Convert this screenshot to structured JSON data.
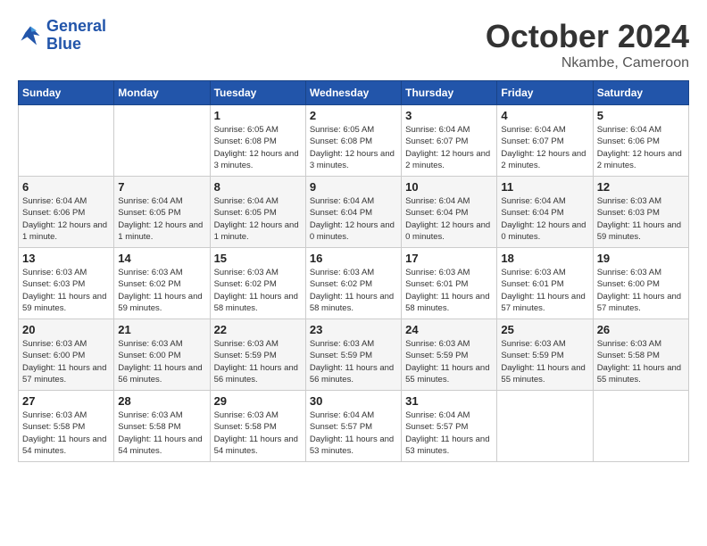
{
  "header": {
    "logo_line1": "General",
    "logo_line2": "Blue",
    "month": "October 2024",
    "location": "Nkambe, Cameroon"
  },
  "weekdays": [
    "Sunday",
    "Monday",
    "Tuesday",
    "Wednesday",
    "Thursday",
    "Friday",
    "Saturday"
  ],
  "weeks": [
    [
      {
        "day": "",
        "info": ""
      },
      {
        "day": "",
        "info": ""
      },
      {
        "day": "1",
        "info": "Sunrise: 6:05 AM\nSunset: 6:08 PM\nDaylight: 12 hours\nand 3 minutes."
      },
      {
        "day": "2",
        "info": "Sunrise: 6:05 AM\nSunset: 6:08 PM\nDaylight: 12 hours\nand 3 minutes."
      },
      {
        "day": "3",
        "info": "Sunrise: 6:04 AM\nSunset: 6:07 PM\nDaylight: 12 hours\nand 2 minutes."
      },
      {
        "day": "4",
        "info": "Sunrise: 6:04 AM\nSunset: 6:07 PM\nDaylight: 12 hours\nand 2 minutes."
      },
      {
        "day": "5",
        "info": "Sunrise: 6:04 AM\nSunset: 6:06 PM\nDaylight: 12 hours\nand 2 minutes."
      }
    ],
    [
      {
        "day": "6",
        "info": "Sunrise: 6:04 AM\nSunset: 6:06 PM\nDaylight: 12 hours\nand 1 minute."
      },
      {
        "day": "7",
        "info": "Sunrise: 6:04 AM\nSunset: 6:05 PM\nDaylight: 12 hours\nand 1 minute."
      },
      {
        "day": "8",
        "info": "Sunrise: 6:04 AM\nSunset: 6:05 PM\nDaylight: 12 hours\nand 1 minute."
      },
      {
        "day": "9",
        "info": "Sunrise: 6:04 AM\nSunset: 6:04 PM\nDaylight: 12 hours\nand 0 minutes."
      },
      {
        "day": "10",
        "info": "Sunrise: 6:04 AM\nSunset: 6:04 PM\nDaylight: 12 hours\nand 0 minutes."
      },
      {
        "day": "11",
        "info": "Sunrise: 6:04 AM\nSunset: 6:04 PM\nDaylight: 12 hours\nand 0 minutes."
      },
      {
        "day": "12",
        "info": "Sunrise: 6:03 AM\nSunset: 6:03 PM\nDaylight: 11 hours\nand 59 minutes."
      }
    ],
    [
      {
        "day": "13",
        "info": "Sunrise: 6:03 AM\nSunset: 6:03 PM\nDaylight: 11 hours\nand 59 minutes."
      },
      {
        "day": "14",
        "info": "Sunrise: 6:03 AM\nSunset: 6:02 PM\nDaylight: 11 hours\nand 59 minutes."
      },
      {
        "day": "15",
        "info": "Sunrise: 6:03 AM\nSunset: 6:02 PM\nDaylight: 11 hours\nand 58 minutes."
      },
      {
        "day": "16",
        "info": "Sunrise: 6:03 AM\nSunset: 6:02 PM\nDaylight: 11 hours\nand 58 minutes."
      },
      {
        "day": "17",
        "info": "Sunrise: 6:03 AM\nSunset: 6:01 PM\nDaylight: 11 hours\nand 58 minutes."
      },
      {
        "day": "18",
        "info": "Sunrise: 6:03 AM\nSunset: 6:01 PM\nDaylight: 11 hours\nand 57 minutes."
      },
      {
        "day": "19",
        "info": "Sunrise: 6:03 AM\nSunset: 6:00 PM\nDaylight: 11 hours\nand 57 minutes."
      }
    ],
    [
      {
        "day": "20",
        "info": "Sunrise: 6:03 AM\nSunset: 6:00 PM\nDaylight: 11 hours\nand 57 minutes."
      },
      {
        "day": "21",
        "info": "Sunrise: 6:03 AM\nSunset: 6:00 PM\nDaylight: 11 hours\nand 56 minutes."
      },
      {
        "day": "22",
        "info": "Sunrise: 6:03 AM\nSunset: 5:59 PM\nDaylight: 11 hours\nand 56 minutes."
      },
      {
        "day": "23",
        "info": "Sunrise: 6:03 AM\nSunset: 5:59 PM\nDaylight: 11 hours\nand 56 minutes."
      },
      {
        "day": "24",
        "info": "Sunrise: 6:03 AM\nSunset: 5:59 PM\nDaylight: 11 hours\nand 55 minutes."
      },
      {
        "day": "25",
        "info": "Sunrise: 6:03 AM\nSunset: 5:59 PM\nDaylight: 11 hours\nand 55 minutes."
      },
      {
        "day": "26",
        "info": "Sunrise: 6:03 AM\nSunset: 5:58 PM\nDaylight: 11 hours\nand 55 minutes."
      }
    ],
    [
      {
        "day": "27",
        "info": "Sunrise: 6:03 AM\nSunset: 5:58 PM\nDaylight: 11 hours\nand 54 minutes."
      },
      {
        "day": "28",
        "info": "Sunrise: 6:03 AM\nSunset: 5:58 PM\nDaylight: 11 hours\nand 54 minutes."
      },
      {
        "day": "29",
        "info": "Sunrise: 6:03 AM\nSunset: 5:58 PM\nDaylight: 11 hours\nand 54 minutes."
      },
      {
        "day": "30",
        "info": "Sunrise: 6:04 AM\nSunset: 5:57 PM\nDaylight: 11 hours\nand 53 minutes."
      },
      {
        "day": "31",
        "info": "Sunrise: 6:04 AM\nSunset: 5:57 PM\nDaylight: 11 hours\nand 53 minutes."
      },
      {
        "day": "",
        "info": ""
      },
      {
        "day": "",
        "info": ""
      }
    ]
  ]
}
